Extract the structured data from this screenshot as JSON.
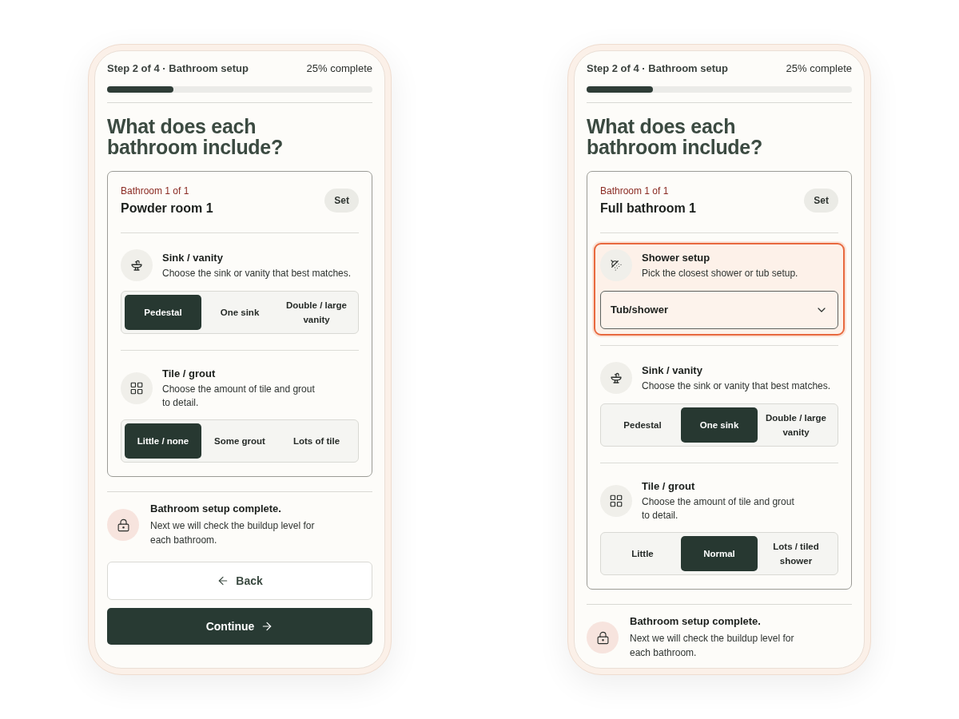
{
  "phones": [
    {
      "header": {
        "step": "Step 2 of 4 · Bathroom setup",
        "progress_text": "25% complete",
        "level": 0.25
      },
      "heading": "What does each bathroom include?",
      "bathroom": {
        "counter": "Bathroom 1 of 1",
        "name": "Powder room 1",
        "set_button": "Set",
        "sections": [
          {
            "kind": "sink",
            "highlighted": false,
            "title": "Sink / vanity",
            "description": "Choose the sink or vanity that best matches.",
            "options": [
              {
                "label": "Pedestal",
                "selected": true
              },
              {
                "label": "One sink",
                "selected": false
              },
              {
                "label": "Double / large vanity",
                "selected": false
              }
            ]
          },
          {
            "kind": "tile",
            "highlighted": false,
            "title": "Tile / grout",
            "description": "Choose the amount of tile and grout to detail.",
            "options": [
              {
                "label": "Little / none",
                "selected": true
              },
              {
                "label": "Some grout",
                "selected": false
              },
              {
                "label": "Lots of tile",
                "selected": false
              }
            ]
          }
        ]
      },
      "notice": {
        "title": "Bathroom setup complete.",
        "text": "Next we will check the buildup level for each bathroom."
      },
      "buttons": [
        {
          "kind": "back",
          "label": "Back"
        },
        {
          "kind": "continue",
          "label": "Continue"
        }
      ]
    },
    {
      "header": {
        "step": "Step 2 of 4 · Bathroom setup",
        "progress_text": "25% complete",
        "level": 0.25
      },
      "heading": "What does each bathroom include?",
      "bathroom": {
        "counter": "Bathroom 1 of 1",
        "name": "Full bathroom 1",
        "set_button": "Set",
        "sections": [
          {
            "kind": "shower",
            "highlighted": true,
            "title": "Shower setup",
            "description": "Pick the closest shower or tub setup.",
            "dropdown": {
              "value": "Tub/shower"
            }
          },
          {
            "kind": "sink",
            "highlighted": false,
            "title": "Sink / vanity",
            "description": "Choose the sink or vanity that best matches.",
            "options": [
              {
                "label": "Pedestal",
                "selected": false
              },
              {
                "label": "One sink",
                "selected": true
              },
              {
                "label": "Double / large vanity",
                "selected": false
              }
            ]
          },
          {
            "kind": "tile",
            "highlighted": false,
            "title": "Tile / grout",
            "description": "Choose the amount of tile and grout to detail.",
            "options": [
              {
                "label": "Little",
                "selected": false
              },
              {
                "label": "Normal",
                "selected": true
              },
              {
                "label": "Lots / tiled shower",
                "selected": false
              }
            ]
          }
        ]
      },
      "notice": {
        "title": "Bathroom setup complete.",
        "text": "Next we will check the buildup level for each bathroom."
      }
    }
  ]
}
